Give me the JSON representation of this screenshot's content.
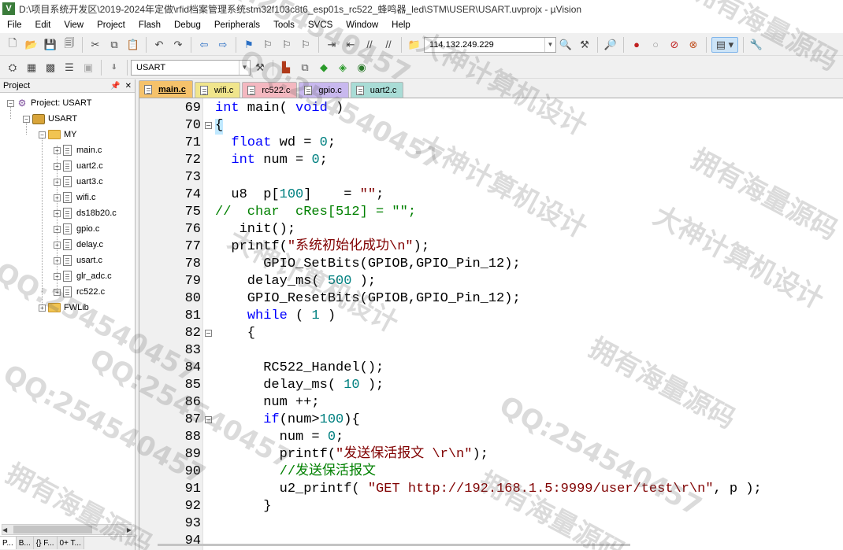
{
  "window": {
    "title": "D:\\项目系统开发区\\2019-2024年定做\\rfid档案管理系统stm32f103c8t6_esp01s_rc522_蜂鸣器_led\\STM\\USER\\USART.uvprojx - µVision",
    "app_icon": "uv-icon"
  },
  "menu": [
    "File",
    "Edit",
    "View",
    "Project",
    "Flash",
    "Debug",
    "Peripherals",
    "Tools",
    "SVCS",
    "Window",
    "Help"
  ],
  "toolbar1": {
    "ip_combo": "114.132.249.229"
  },
  "toolbar2": {
    "target_combo": "USART"
  },
  "project_panel": {
    "title": "Project",
    "tree": {
      "root": "Project: USART",
      "target": "USART",
      "group_my": "MY",
      "files": [
        "main.c",
        "uart2.c",
        "uart3.c",
        "wifi.c",
        "ds18b20.c",
        "gpio.c",
        "delay.c",
        "usart.c",
        "glr_adc.c",
        "rc522.c"
      ],
      "group_fwlib": "FWLib"
    },
    "tabs": [
      "P...",
      "B...",
      "{} F...",
      "0+ T..."
    ]
  },
  "editor": {
    "tabs": [
      {
        "label": "main.c",
        "color": "#f5c26b",
        "active": true
      },
      {
        "label": "wifi.c",
        "color": "#f0e58c",
        "active": false
      },
      {
        "label": "rc522.c",
        "color": "#f4b8c0",
        "active": false
      },
      {
        "label": "gpio.c",
        "color": "#c8b8ee",
        "active": false
      },
      {
        "label": "uart2.c",
        "color": "#a9dcd6",
        "active": false
      }
    ],
    "lines": [
      {
        "n": "69",
        "fold": "",
        "html": "<span class=\"kw\">int</span> main( <span class=\"kw\">void</span> )"
      },
      {
        "n": "70",
        "fold": "minus",
        "html": "{"
      },
      {
        "n": "71",
        "fold": "",
        "html": "  <span class=\"kw\">float</span> wd = <span class=\"num\">0</span>;"
      },
      {
        "n": "72",
        "fold": "",
        "html": "  <span class=\"kw\">int</span> num = <span class=\"num\">0</span>;"
      },
      {
        "n": "73",
        "fold": "",
        "html": ""
      },
      {
        "n": "74",
        "fold": "",
        "html": "  u8  p[<span class=\"num\">100</span>]    = <span class=\"str\">\"\"</span>;"
      },
      {
        "n": "75",
        "fold": "",
        "html": "<span class=\"cm\">//  char  cRes[512] = \"\";</span>"
      },
      {
        "n": "76",
        "fold": "",
        "html": "   init();"
      },
      {
        "n": "77",
        "fold": "",
        "html": "  printf(<span class=\"str\">\"系统初始化成功\\n\"</span>);"
      },
      {
        "n": "78",
        "fold": "",
        "html": "      GPIO_SetBits(GPIOB,GPIO_Pin_12);"
      },
      {
        "n": "79",
        "fold": "",
        "html": "    delay_ms( <span class=\"num\">500</span> );"
      },
      {
        "n": "80",
        "fold": "",
        "html": "    GPIO_ResetBits(GPIOB,GPIO_Pin_12);"
      },
      {
        "n": "81",
        "fold": "",
        "html": "    <span class=\"kw\">while</span> ( <span class=\"num\">1</span> )"
      },
      {
        "n": "82",
        "fold": "minus",
        "html": "    {"
      },
      {
        "n": "83",
        "fold": "",
        "html": ""
      },
      {
        "n": "84",
        "fold": "",
        "html": "      RC522_Handel();"
      },
      {
        "n": "85",
        "fold": "",
        "html": "      delay_ms( <span class=\"num\">10</span> );"
      },
      {
        "n": "86",
        "fold": "",
        "html": "      num ++;"
      },
      {
        "n": "87",
        "fold": "minus",
        "html": "      <span class=\"kw\">if</span>(num><span class=\"num\">100</span>){"
      },
      {
        "n": "88",
        "fold": "",
        "html": "        num = <span class=\"num\">0</span>;"
      },
      {
        "n": "89",
        "fold": "",
        "html": "        printf(<span class=\"str\">\"发送保活报文 \\r\\n\"</span>);"
      },
      {
        "n": "90",
        "fold": "",
        "html": "        <span class=\"cm\">//发送保活报文</span>"
      },
      {
        "n": "91",
        "fold": "",
        "html": "        u2_printf( <span class=\"str\">\"GET http://192.168.1.5:9999/user/test\\r\\n\"</span>, p );"
      },
      {
        "n": "92",
        "fold": "",
        "html": "      }"
      },
      {
        "n": "93",
        "fold": "",
        "html": ""
      },
      {
        "n": "94",
        "fold": "",
        "html": ""
      }
    ]
  },
  "watermarks": [
    "QQ:254540457",
    "大神计算机设计",
    "拥有海量源码",
    "QQ:254540457",
    "大神计算机设计",
    "拥有海量源码",
    "QQ:254540457",
    "大神计算机设计",
    "拥有海量源码",
    "QQ:254540457",
    "拥有海量源码",
    "QQ:254540457",
    "大神计算机设计",
    "拥有海量源码",
    "QQ:254540457"
  ]
}
